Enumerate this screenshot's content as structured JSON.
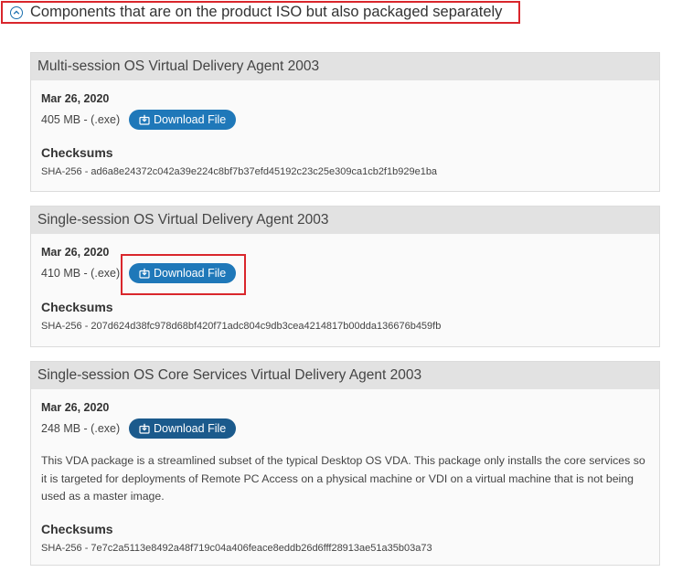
{
  "section": {
    "title": "Components that are on the product ISO but also packaged separately",
    "toggle_icon": "chevron-up-circle-icon"
  },
  "cards": [
    {
      "title": "Multi-session OS Virtual Delivery Agent 2003",
      "date": "Mar 26, 2020",
      "size": "405 MB - (.exe)",
      "download_label": "Download File",
      "checksums_title": "Checksums",
      "checksum": "SHA-256 - ad6a8e24372c042a39e224c8bf7b37efd45192c23c25e309ca1cb2f1b929e1ba"
    },
    {
      "title": "Single-session OS Virtual Delivery Agent 2003",
      "date": "Mar 26, 2020",
      "size": "410 MB - (.exe)",
      "download_label": "Download File",
      "checksums_title": "Checksums",
      "checksum": "SHA-256 - 207d624d38fc978d68bf420f71adc804c9db3cea4214817b00dda136676b459fb"
    },
    {
      "title": "Single-session OS Core Services Virtual Delivery Agent 2003",
      "date": "Mar 26, 2020",
      "size": "248 MB - (.exe)",
      "download_label": "Download File",
      "description": "This VDA package is a streamlined subset of the typical Desktop OS VDA. This package only installs the core services so it is targeted for deployments of Remote PC Access on a physical machine or VDI on a virtual machine that is not being used as a master image.",
      "checksums_title": "Checksums",
      "checksum": "SHA-256 - 7e7c2a5113e8492a48f719c04a406feace8eddb26d6fff28913ae51a35b03a73"
    }
  ],
  "colors": {
    "accent": "#1f78b9",
    "accent_dark": "#1b5a8c",
    "highlight": "#d9262c"
  }
}
